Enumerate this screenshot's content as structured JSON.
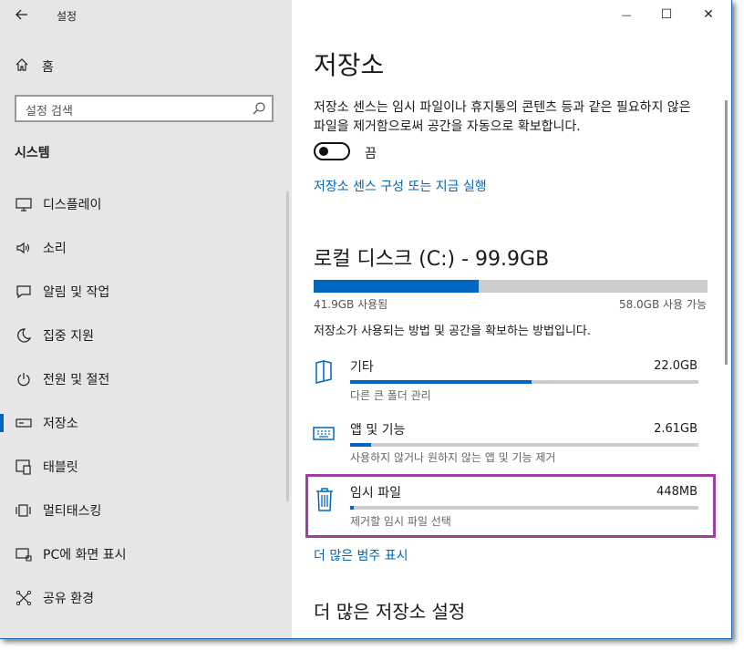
{
  "window": {
    "app_title": "설정",
    "back_icon": "back-arrow-icon",
    "minimize_glyph": "—",
    "maximize_glyph": "☐",
    "close_glyph": "✕"
  },
  "sidebar": {
    "home_label": "홈",
    "search_placeholder": "설정 검색",
    "section_title": "시스템",
    "items": [
      {
        "label": "디스플레이",
        "icon": "monitor-icon",
        "active": false
      },
      {
        "label": "소리",
        "icon": "speaker-icon",
        "active": false
      },
      {
        "label": "알림 및 작업",
        "icon": "notification-icon",
        "active": false
      },
      {
        "label": "집중 지원",
        "icon": "moon-icon",
        "active": false
      },
      {
        "label": "전원 및 절전",
        "icon": "power-icon",
        "active": false
      },
      {
        "label": "저장소",
        "icon": "storage-icon",
        "active": true
      },
      {
        "label": "태블릿",
        "icon": "tablet-icon",
        "active": false
      },
      {
        "label": "멀티태스킹",
        "icon": "multitasking-icon",
        "active": false
      },
      {
        "label": "PC에 화면 표시",
        "icon": "project-icon",
        "active": false
      },
      {
        "label": "공유 환경",
        "icon": "shared-experience-icon",
        "active": false
      }
    ]
  },
  "main": {
    "title": "저장소",
    "description": "저장소 센스는 임시 파일이나 휴지통의 콘텐츠 등과 같은 필요하지 않은 파일을 제거함으로써 공간을 자동으로 확보합니다.",
    "storage_sense_state": "끔",
    "storage_sense_link": "저장소 센스 구성 또는 지금 실행",
    "drive": {
      "title": "로컬 디스크 (C:) - 99.9GB",
      "used_label": "41.9GB 사용됨",
      "free_label": "58.0GB 사용 가능",
      "used_fraction": 0.42
    },
    "usage_caption": "저장소가 사용되는 방법 및 공간을 확보하는 방법입니다.",
    "categories": [
      {
        "name": "기타",
        "size": "22.0GB",
        "sub": "다른 큰 폴더 관리",
        "fraction": 0.52,
        "icon": "folder-icon"
      },
      {
        "name": "앱 및 기능",
        "size": "2.61GB",
        "sub": "사용하지 않거나 원하지 않는 앱 및 기능 제거",
        "fraction": 0.06,
        "icon": "keyboard-icon"
      },
      {
        "name": "임시 파일",
        "size": "448MB",
        "sub": "제거할 임시 파일 선택",
        "fraction": 0.01,
        "icon": "trash-icon"
      }
    ],
    "more_categories_link": "더 많은 범주 표시",
    "more_settings_title": "더 많은 저장소 설정"
  },
  "colors": {
    "accent": "#0067c0",
    "link": "#0066b4",
    "highlight_border": "#9b3fa3",
    "sidebar_bg": "#e6e6e6"
  }
}
